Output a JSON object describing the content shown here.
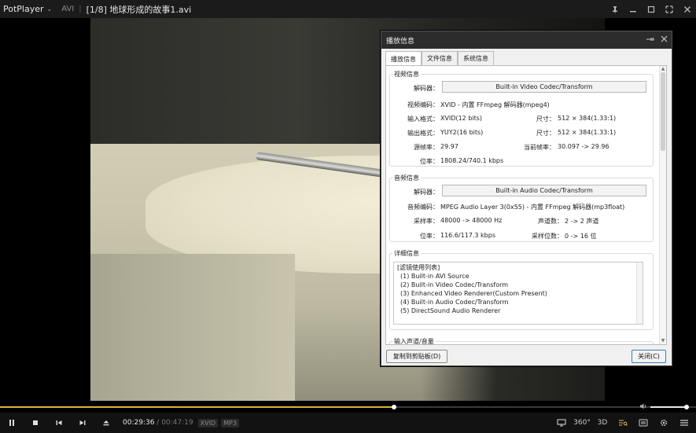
{
  "titlebar": {
    "app_name": "PotPlayer",
    "format": "AVI",
    "title": "[1/8] 地球形成的故事1.avi",
    "buttons": [
      "pin-icon",
      "minimize-icon",
      "restore-icon",
      "maximize-icon",
      "close-icon"
    ]
  },
  "playback": {
    "current_time": "00:29:36",
    "separator": " / ",
    "total_time": "00:47:19",
    "video_codec_badge": "XVID",
    "audio_codec_badge": "MP3",
    "progress_fraction": 0.566,
    "volume_fraction": 0.88
  },
  "right_controls": {
    "vr_label": "360°",
    "3d_label": "3D"
  },
  "dialog": {
    "title": "播放信息",
    "tabs": [
      "播放信息",
      "文件信息",
      "系统信息"
    ],
    "active_tab": 0,
    "video": {
      "group_label": "视频信息",
      "decoder_label": "解码器：",
      "decoder_value": "Built-in Video Codec/Transform",
      "codec_label": "视频编码：",
      "codec_value": "XVID - 内置 FFmpeg 解码器(mpeg4)",
      "input_label": "输入格式：",
      "input_value": "XVID(12 bits)",
      "input_size_label": "尺寸：",
      "input_size_value": "512 × 384(1.33:1)",
      "output_label": "输出格式：",
      "output_value": "YUY2(16 bits)",
      "output_size_label": "尺寸：",
      "output_size_value": "512 × 384(1.33:1)",
      "src_fps_label": "源帧率：",
      "src_fps_value": "29.97",
      "cur_fps_label": "当前帧率：",
      "cur_fps_value": "30.097 -> 29.96",
      "bitrate_label": "位率：",
      "bitrate_value": "1808.24/740.1 kbps"
    },
    "audio": {
      "group_label": "音频信息",
      "decoder_label": "解码器：",
      "decoder_value": "Built-in Audio Codec/Transform",
      "codec_label": "音频编码：",
      "codec_value": "MPEG Audio Layer 3(0x55) - 内置 FFmpeg 解码器(mp3float)",
      "sample_label": "采样率：",
      "sample_value": "48000 -> 48000 Hz",
      "channels_label": "声道数：",
      "channels_value": "2 -> 2 声道",
      "bitrate_label": "位率：",
      "bitrate_value": "116.6/117.3 kbps",
      "bits_label": "采样位数：",
      "bits_value": "0 -> 16 位"
    },
    "details": {
      "group_label": "详细信息",
      "lines": [
        "[滤镜使用列表]",
        "  (1) Built-in AVI Source",
        "  (2) Built-in Video Codec/Transform",
        "  (3) Enhanced Video Renderer(Custom Present)",
        "  (4) Built-in Audio Codec/Transform",
        "  (5) DirectSound Audio Renderer"
      ]
    },
    "input_channel_label": "输入声道/音量",
    "copy_button": "复制到剪贴板(D)",
    "close_button": "关闭(C)"
  }
}
